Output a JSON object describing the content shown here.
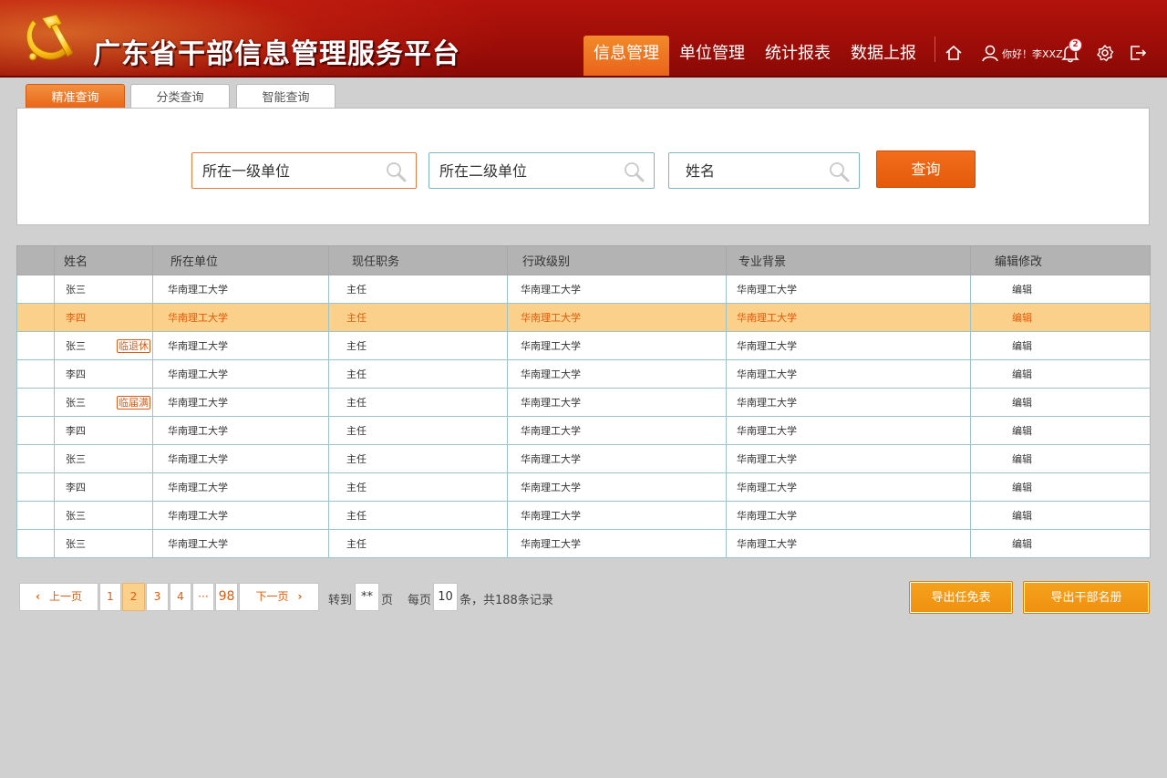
{
  "header": {
    "title": "广东省干部信息管理服务平台",
    "nav": [
      "信息管理",
      "单位管理",
      "统计报表",
      "数据上报"
    ],
    "active_nav": 0,
    "greeting": "你好！李XXZ",
    "notification_count": "2",
    "icons": [
      "party-emblem-icon",
      "home-icon",
      "user-icon",
      "bell-icon",
      "gear-icon",
      "logout-icon"
    ]
  },
  "tabs": [
    "精准查询",
    "分类查询",
    "智能查询"
  ],
  "search": {
    "field1_placeholder": "所在一级单位",
    "field2_placeholder": "所在二级单位",
    "field3_placeholder": "姓名",
    "button": "查询"
  },
  "table": {
    "columns": [
      "姓名",
      "所在单位",
      "现任职务",
      "行政级别",
      "专业背景",
      "编辑修改"
    ],
    "rows": [
      {
        "name": "张三",
        "tag": "",
        "unit": "华南理工大学",
        "position": "主任",
        "level": "华南理工大学",
        "background": "华南理工大学",
        "edit": "编辑"
      },
      {
        "name": "李四",
        "tag": "",
        "unit": "华南理工大学",
        "position": "主任",
        "level": "华南理工大学",
        "background": "华南理工大学",
        "edit": "编辑"
      },
      {
        "name": "张三",
        "tag": "临退休",
        "unit": "华南理工大学",
        "position": "主任",
        "level": "华南理工大学",
        "background": "华南理工大学",
        "edit": "编辑"
      },
      {
        "name": "李四",
        "tag": "",
        "unit": "华南理工大学",
        "position": "主任",
        "level": "华南理工大学",
        "background": "华南理工大学",
        "edit": "编辑"
      },
      {
        "name": "张三",
        "tag": "临届满",
        "unit": "华南理工大学",
        "position": "主任",
        "level": "华南理工大学",
        "background": "华南理工大学",
        "edit": "编辑"
      },
      {
        "name": "李四",
        "tag": "",
        "unit": "华南理工大学",
        "position": "主任",
        "level": "华南理工大学",
        "background": "华南理工大学",
        "edit": "编辑"
      },
      {
        "name": "张三",
        "tag": "",
        "unit": "华南理工大学",
        "position": "主任",
        "level": "华南理工大学",
        "background": "华南理工大学",
        "edit": "编辑"
      },
      {
        "name": "李四",
        "tag": "",
        "unit": "华南理工大学",
        "position": "主任",
        "level": "华南理工大学",
        "background": "华南理工大学",
        "edit": "编辑"
      },
      {
        "name": "张三",
        "tag": "",
        "unit": "华南理工大学",
        "position": "主任",
        "level": "华南理工大学",
        "background": "华南理工大学",
        "edit": "编辑"
      },
      {
        "name": "张三",
        "tag": "",
        "unit": "华南理工大学",
        "position": "主任",
        "level": "华南理工大学",
        "background": "华南理工大学",
        "edit": "编辑"
      }
    ],
    "highlighted_row": 1
  },
  "pagination": {
    "prev": "上一页",
    "pages": [
      "1",
      "2",
      "3",
      "4",
      "···",
      "98"
    ],
    "current_page": "2",
    "next": "下一页",
    "goto_label": "转到",
    "goto_value": "**",
    "page_unit": "页",
    "per_page_label": "每页",
    "per_page_value": "10",
    "total_text": "条，共188条记录"
  },
  "exports": [
    "导出任免表",
    "导出干部名册"
  ],
  "colors": {
    "header_red": "#9e0d08",
    "accent_orange": "#e9621a",
    "highlight_row": "#fad08a",
    "export_orange": "#f39a16"
  }
}
